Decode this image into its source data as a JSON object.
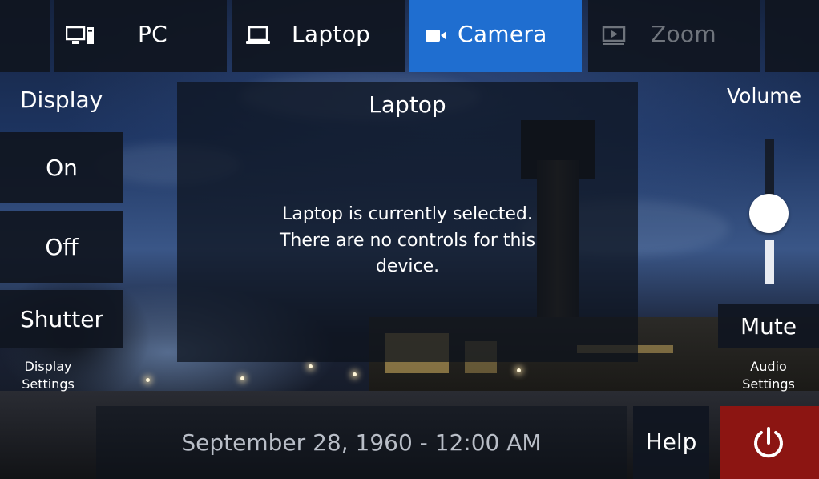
{
  "sources": [
    {
      "label": "PC",
      "icon": "desktop-icon",
      "state": "normal"
    },
    {
      "label": "Laptop",
      "icon": "laptop-icon",
      "state": "normal"
    },
    {
      "label": "Camera",
      "icon": "video-camera-icon",
      "state": "active"
    },
    {
      "label": "Zoom",
      "icon": "presentation-screen-icon",
      "state": "disabled"
    }
  ],
  "display": {
    "title": "Display",
    "on_label": "On",
    "off_label": "Off",
    "shutter_label": "Shutter",
    "settings_label_line1": "Display",
    "settings_label_line2": "Settings"
  },
  "panel": {
    "title": "Laptop",
    "message_line1": "Laptop is currently selected.",
    "message_line2": "There are no controls for this",
    "message_line3": "device."
  },
  "audio": {
    "volume_title": "Volume",
    "volume_level": 0.55,
    "mute_label": "Mute",
    "settings_label_line1": "Audio",
    "settings_label_line2": "Settings"
  },
  "footer": {
    "datetime": "September 28, 1960 - 12:00 AM",
    "help_label": "Help",
    "power_icon": "power-icon"
  },
  "colors": {
    "active_tab": "#1f6ed0",
    "power_button": "#8c1512",
    "button_bg": "#101620"
  }
}
